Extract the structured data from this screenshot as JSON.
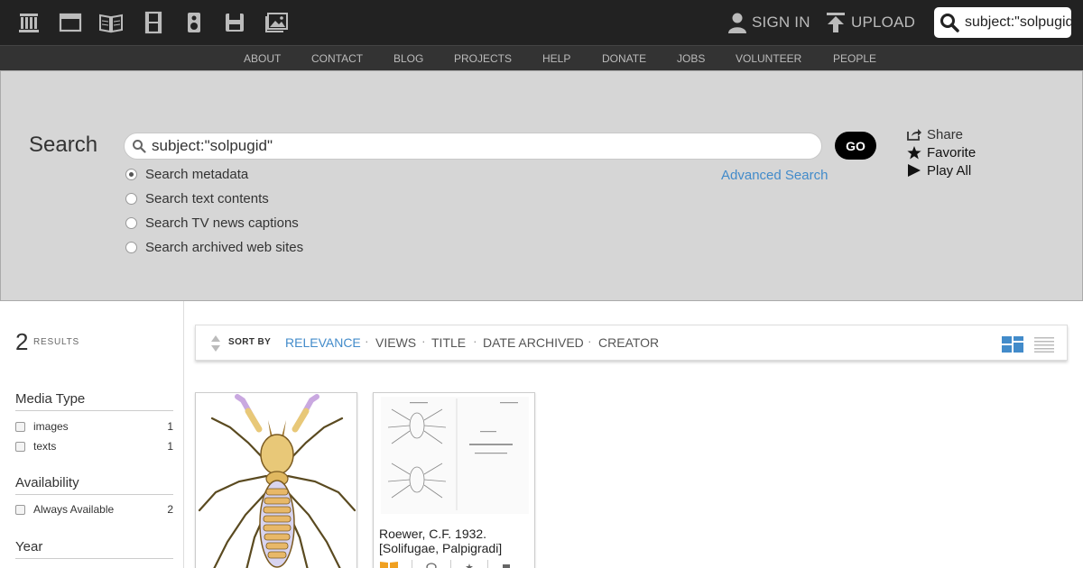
{
  "topbar": {
    "media_icons": [
      "archive-home-icon",
      "web-icon",
      "texts-icon",
      "video-icon",
      "audio-icon",
      "software-icon",
      "images-icon"
    ],
    "signin_label": "SIGN IN",
    "upload_label": "UPLOAD",
    "search_value": "subject:\"solpugid\""
  },
  "nav": {
    "items": [
      "ABOUT",
      "CONTACT",
      "BLOG",
      "PROJECTS",
      "HELP",
      "DONATE",
      "JOBS",
      "VOLUNTEER",
      "PEOPLE"
    ]
  },
  "search": {
    "title": "Search",
    "query": "subject:\"solpugid\"",
    "go_label": "GO",
    "options": [
      "Search metadata",
      "Search text contents",
      "Search TV news captions",
      "Search archived web sites"
    ],
    "selected_option": "Search metadata",
    "advanced_label": "Advanced Search",
    "actions": {
      "share": "Share",
      "favorite": "Favorite",
      "play_all": "Play All"
    }
  },
  "results": {
    "count": "2",
    "label": "RESULTS"
  },
  "facets": {
    "media_type": {
      "title": "Media Type",
      "items": [
        {
          "label": "images",
          "count": "1"
        },
        {
          "label": "texts",
          "count": "1"
        }
      ]
    },
    "availability": {
      "title": "Availability",
      "items": [
        {
          "label": "Always Available",
          "count": "2"
        }
      ]
    },
    "year": {
      "title": "Year"
    }
  },
  "sort": {
    "label": "SORT BY",
    "options": [
      "RELEVANCE",
      "VIEWS",
      "TITLE",
      "DATE ARCHIVED",
      "CREATOR"
    ],
    "active": "RELEVANCE"
  },
  "tiles": [
    {
      "title": "",
      "media": "image"
    },
    {
      "title": "Roewer, C.F. 1932. [Solifugae, Palpigradi]",
      "media": "texts"
    }
  ],
  "colors": {
    "topbar_bg": "#222222",
    "navbar_bg": "#333333",
    "panel_bg": "#d6d6d6",
    "link_blue": "#428bca"
  }
}
